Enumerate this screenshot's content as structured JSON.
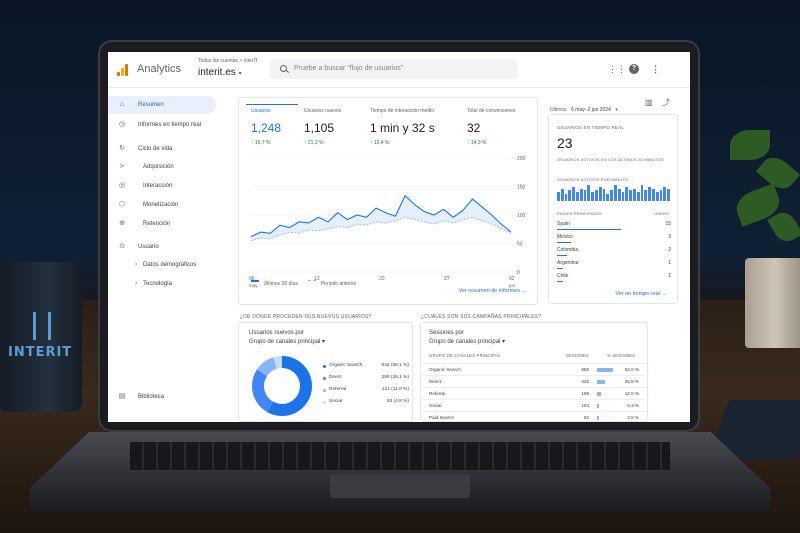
{
  "app": {
    "title": "Analytics",
    "breadcrumb": "Todas las cuentas > interIT",
    "property": "interit.es",
    "search_placeholder": "Pruebe a buscar \"flujo de usuarios\""
  },
  "sidebar": {
    "items": [
      {
        "label": "Resumen",
        "icon": "home-icon",
        "active": true
      },
      {
        "label": "Informes en tiempo real",
        "icon": "clock-icon"
      },
      {
        "label": "Ciclo de vida",
        "icon": "cycle-icon"
      },
      {
        "label": "Adquisición",
        "icon": "acquisition-icon"
      },
      {
        "label": "Interacción",
        "icon": "interaction-icon"
      },
      {
        "label": "Monetización",
        "icon": "monetization-icon"
      },
      {
        "label": "Retención",
        "icon": "retention-icon"
      },
      {
        "label": "Usuario",
        "icon": "user-icon"
      },
      {
        "label": "Datos demográficos",
        "icon": "chevron-right-icon"
      },
      {
        "label": "Tecnología",
        "icon": "chevron-right-icon"
      },
      {
        "label": "Biblioteca",
        "icon": "library-icon"
      }
    ]
  },
  "date_range": {
    "prefix": "Últimos",
    "range": "6 may–2 jun 2024"
  },
  "metrics": [
    {
      "label": "Usuarios",
      "value": "1,248",
      "delta": "↑ 16,7 %",
      "selected": true
    },
    {
      "label": "Usuarios nuevos",
      "value": "1,105",
      "delta": "↑ 21,3 %"
    },
    {
      "label": "Tiempo de interacción medio",
      "value": "1 min y 32 s",
      "delta": "↑ 12,4 %"
    },
    {
      "label": "Total de conversiones",
      "value": "32",
      "delta": "↑ 14,3 %"
    }
  ],
  "chart_data": {
    "type": "line",
    "x": [
      "06 may",
      "13",
      "20",
      "27",
      "02 jun"
    ],
    "ylim": [
      0,
      200
    ],
    "yticks": [
      "200",
      "150",
      "100",
      "50",
      "0"
    ],
    "series": [
      {
        "name": "Últimos 28 días",
        "values": [
          62,
          70,
          68,
          82,
          78,
          88,
          86,
          96,
          88,
          104,
          92,
          100,
          96,
          112,
          104,
          98,
          134,
          118,
          106,
          100,
          110,
          96,
          108,
          128,
          114,
          100,
          84,
          70
        ]
      },
      {
        "name": "Periodo anterior",
        "values": [
          55,
          60,
          58,
          65,
          70,
          68,
          74,
          72,
          76,
          80,
          78,
          84,
          82,
          88,
          86,
          90,
          96,
          92,
          88,
          84,
          90,
          86,
          92,
          96,
          90,
          84,
          76,
          68
        ]
      }
    ]
  },
  "overview_link": "Ver resumen de informes →",
  "realtime": {
    "title": "USUARIOS EN TIEMPO REAL",
    "value": "23",
    "sub": "USUARIOS ACTIVOS EN LOS ÚLTIMOS 30 MINUTOS",
    "per_minute": "USUARIOS ACTIVOS POR MINUTO",
    "bars": [
      5,
      7,
      4,
      6,
      8,
      5,
      7,
      6,
      9,
      5,
      6,
      8,
      7,
      4,
      6,
      9,
      7,
      5,
      8,
      6,
      7,
      5,
      9,
      6,
      8,
      7,
      5,
      6,
      8,
      7
    ],
    "col1": "PAÍSES PRINCIPALES",
    "col2": "USERS",
    "countries": [
      {
        "name": "Spain",
        "value": "15",
        "share": 0.92
      },
      {
        "name": "Mexico",
        "value": "3",
        "share": 0.2
      },
      {
        "name": "Colombia",
        "value": "2",
        "share": 0.14
      },
      {
        "name": "Argentina",
        "value": "1",
        "share": 0.08
      },
      {
        "name": "Chile",
        "value": "1",
        "share": 0.08
      }
    ],
    "link": "Ver en tiempo real →"
  },
  "new_users": {
    "question": "¿DE DÓNDE PROCEDEN SUS NUEVOS USUARIOS?",
    "title": "Usuarios nuevos por",
    "dim": "Grupo de canales principal ▾",
    "segments": [
      {
        "name": "Organic Search",
        "value": "642 (58,1 %)",
        "pct": 58.1,
        "color": "#1a73e8"
      },
      {
        "name": "Direct",
        "value": "289 (26,1 %)",
        "pct": 26.1,
        "color": "#4285f4"
      },
      {
        "name": "Referral",
        "value": "121 (11,0 %)",
        "pct": 11.0,
        "color": "#8ab4f8"
      },
      {
        "name": "Social",
        "value": "53 (4,8 %)",
        "pct": 4.8,
        "color": "#c6dafc"
      }
    ]
  },
  "campaigns": {
    "question": "¿CUÁLES SON SUS CAMPAÑAS PRINCIPALES?",
    "title": "Sesiones por",
    "dim": "Grupo de canales principal ▾",
    "col1": "GRUPO DE CANALES PRINCIPAL",
    "col2": "SESIONES",
    "col3": "% SESIONES",
    "rows": [
      {
        "name": "Organic Search",
        "sessions": "856",
        "pct": "52,0 %",
        "share": 0.52
      },
      {
        "name": "Direct",
        "sessions": "425",
        "pct": "25,8 %",
        "share": 0.258
      },
      {
        "name": "Referral",
        "sessions": "198",
        "pct": "12,0 %",
        "share": 0.12
      },
      {
        "name": "Social",
        "sessions": "104",
        "pct": "6,3 %",
        "share": 0.063
      },
      {
        "name": "Paid Search",
        "sessions": "63",
        "pct": "3,8 %",
        "share": 0.038
      }
    ]
  },
  "decor": {
    "mug_text": "INTERIT"
  }
}
